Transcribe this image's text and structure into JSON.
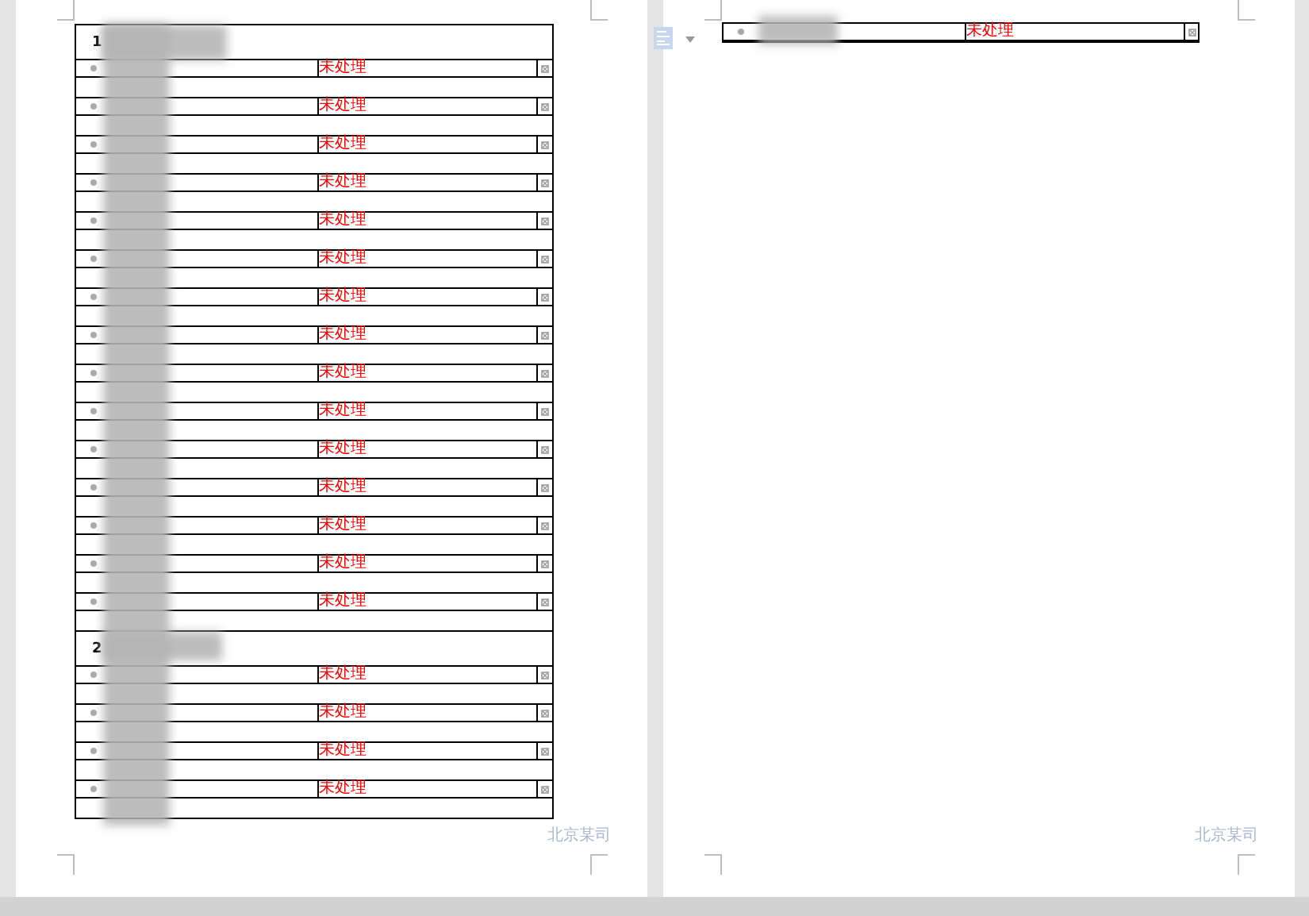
{
  "pages": [
    {
      "groups": [
        {
          "number": "1",
          "items": [
            {
              "status": "未处理"
            },
            {
              "status": "未处理"
            },
            {
              "status": "未处理"
            },
            {
              "status": "未处理"
            },
            {
              "status": "未处理"
            },
            {
              "status": "未处理"
            },
            {
              "status": "未处理"
            },
            {
              "status": "未处理"
            },
            {
              "status": "未处理"
            },
            {
              "status": "未处理"
            },
            {
              "status": "未处理"
            },
            {
              "status": "未处理"
            },
            {
              "status": "未处理"
            },
            {
              "status": "未处理"
            },
            {
              "status": "未处理"
            }
          ]
        },
        {
          "number": "2",
          "items": [
            {
              "status": "未处理"
            },
            {
              "status": "未处理"
            },
            {
              "status": "未处理"
            },
            {
              "status": "未处理"
            }
          ]
        }
      ],
      "footer": "北京某司"
    },
    {
      "groups": [
        {
          "items": [
            {
              "status": "未处理"
            }
          ]
        }
      ],
      "footer": "北京某司"
    }
  ]
}
